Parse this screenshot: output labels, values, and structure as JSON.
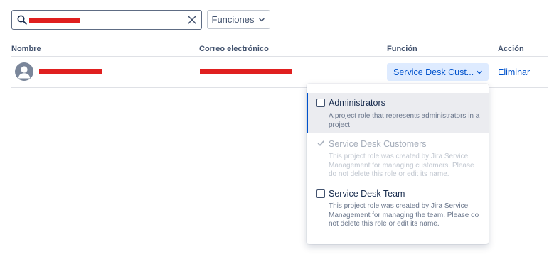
{
  "search": {
    "placeholder": "",
    "icon": "search-icon",
    "clear_icon": "close-icon"
  },
  "filter": {
    "label": "Funciones",
    "icon": "chevron-down-icon"
  },
  "table": {
    "headers": [
      "Nombre",
      "Correo electrónico",
      "Función",
      "Acción"
    ],
    "rows": [
      {
        "avatar_icon": "user-avatar-icon",
        "role": "Service Desk Cust...",
        "action": "Eliminar"
      }
    ]
  },
  "role_menu": {
    "options": [
      {
        "title": "Administrators",
        "description": "A project role that represents administrators in a project",
        "checked": false,
        "disabled": false
      },
      {
        "title": "Service Desk Customers",
        "description": "This project role was created by Jira Service Management for managing customers. Please do not delete this role or edit its name.",
        "checked": true,
        "disabled": true
      },
      {
        "title": "Service Desk Team",
        "description": "This project role was created by Jira Service Management for managing the team. Please do not delete this role or edit its name.",
        "checked": false,
        "disabled": false
      }
    ]
  },
  "colors": {
    "link": "#0052cc",
    "selected_bg": "#deebff",
    "redaction": "#e01f1f"
  }
}
